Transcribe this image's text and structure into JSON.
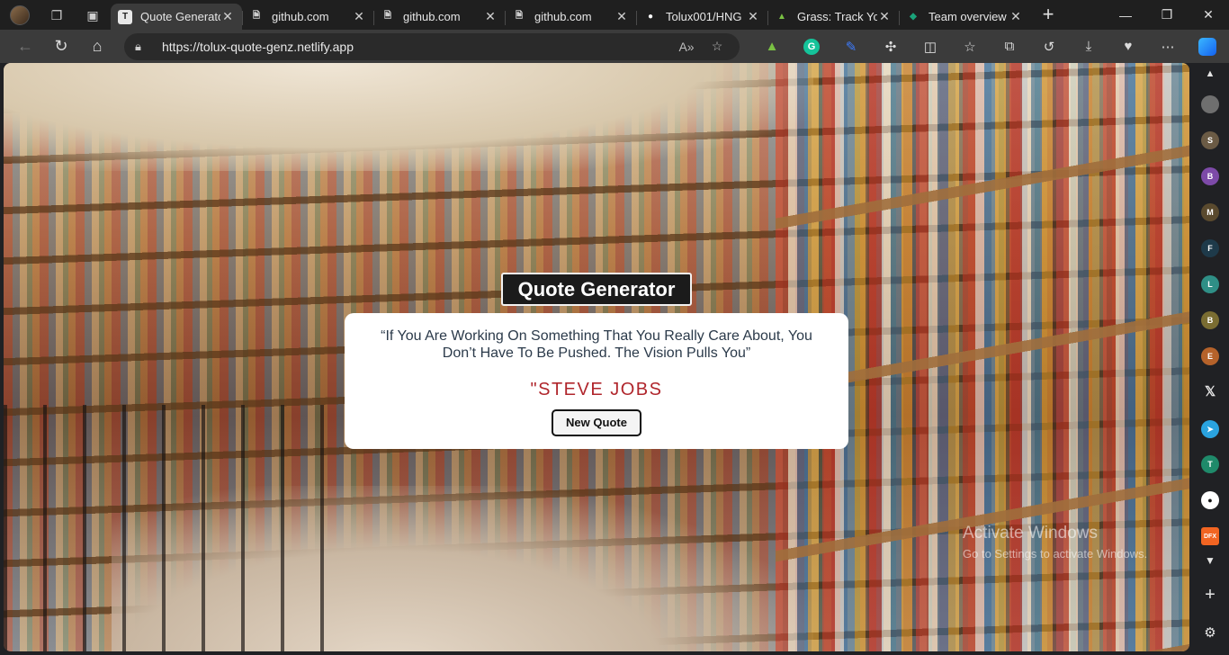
{
  "browser": {
    "tabs": [
      {
        "title": "Quote Generator",
        "favicon": "T",
        "favicon_bg": "#e8e8e8",
        "favicon_fg": "#222222",
        "active": true
      },
      {
        "title": "github.com",
        "favicon": "doc-icon",
        "favicon_bg": "transparent",
        "favicon_fg": "#cfcfcf",
        "active": false
      },
      {
        "title": "github.com",
        "favicon": "doc-icon",
        "favicon_bg": "transparent",
        "favicon_fg": "#cfcfcf",
        "active": false
      },
      {
        "title": "github.com",
        "favicon": "doc-icon",
        "favicon_bg": "transparent",
        "favicon_fg": "#cfcfcf",
        "active": false
      },
      {
        "title": "Tolux001/HNG",
        "favicon": "github-icon",
        "favicon_bg": "transparent",
        "favicon_fg": "#ffffff",
        "active": false
      },
      {
        "title": "Grass: Track Yo",
        "favicon": "grass-icon",
        "favicon_bg": "transparent",
        "favicon_fg": "#7ac143",
        "active": false
      },
      {
        "title": "Team overview",
        "favicon": "diamond-icon",
        "favicon_bg": "transparent",
        "favicon_fg": "#1aa37a",
        "active": false
      }
    ],
    "url": "https://tolux-quote-genz.netlify.app",
    "sidebar_letters": [
      "S",
      "B",
      "M",
      "F",
      "L",
      "B",
      "E"
    ],
    "sidebar_colors": [
      "#6b5b45",
      "#7d4aa8",
      "#5a4a2e",
      "#1e3a4a",
      "#2f8f86",
      "#7a6d32",
      "#b5622a"
    ],
    "watermark": {
      "line1": "Activate Windows",
      "line2": "Go to Settings to activate Windows."
    }
  },
  "app": {
    "title": "Quote Generator",
    "quote": "“If You Are Working On Something That You Really Care About, You Don’t Have To Be Pushed. The Vision Pulls You”",
    "author": "\"STEVE JOBS",
    "button_label": "New Quote"
  },
  "colors": {
    "author": "#b0262c",
    "quote_text": "#2b3a4a",
    "title_bg": "#1b1b1b"
  }
}
